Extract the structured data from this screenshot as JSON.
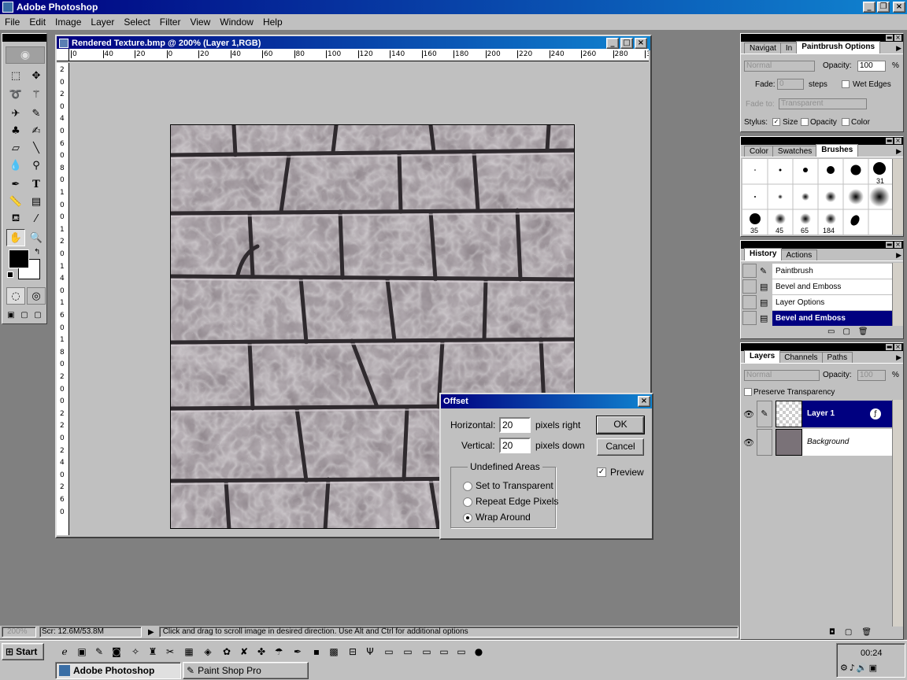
{
  "app": {
    "title": "Adobe Photoshop",
    "min": "_",
    "max": "❐",
    "close": "×"
  },
  "menu": [
    "File",
    "Edit",
    "Image",
    "Layer",
    "Select",
    "Filter",
    "View",
    "Window",
    "Help"
  ],
  "document": {
    "title": "Rendered Texture.bmp @ 200% (Layer 1,RGB)",
    "ruler_h": [
      "0",
      "40",
      "20",
      "0",
      "20",
      "40",
      "60",
      "80",
      "100",
      "120",
      "140",
      "160",
      "180",
      "200",
      "220",
      "240",
      "260",
      "280",
      "300"
    ],
    "ruler_v": [
      "2",
      "0",
      "2",
      "0",
      "4",
      "0",
      "6",
      "0",
      "8",
      "0",
      "1",
      "0",
      "0",
      "1",
      "2",
      "0",
      "1",
      "4",
      "0",
      "1",
      "6",
      "0",
      "1",
      "8",
      "0",
      "2",
      "0",
      "0",
      "2",
      "2",
      "0",
      "2",
      "4",
      "0",
      "2",
      "6",
      "0"
    ]
  },
  "dialog": {
    "title": "Offset",
    "horizontal_label": "Horizontal:",
    "horizontal_value": "20",
    "horizontal_unit": "pixels right",
    "vertical_label": "Vertical:",
    "vertical_value": "20",
    "vertical_unit": "pixels down",
    "ok": "OK",
    "cancel": "Cancel",
    "preview": "Preview",
    "preview_checked": true,
    "group_title": "Undefined Areas",
    "options": [
      "Set to Transparent",
      "Repeat Edge Pixels",
      "Wrap Around"
    ],
    "selected_option": 2
  },
  "options_palette": {
    "tabs": [
      "Navigat",
      "In",
      "Paintbrush Options"
    ],
    "mode": "Normal",
    "opacity_label": "Opacity:",
    "opacity_value": "100",
    "pct": "%",
    "fade_label": "Fade:",
    "fade_value": "0",
    "steps": "steps",
    "wet_edges": "Wet Edges",
    "fade_to_label": "Fade to:",
    "fade_to_value": "Transparent",
    "stylus_label": "Stylus:",
    "stylus_size": "Size",
    "stylus_opacity": "Opacity",
    "stylus_color": "Color"
  },
  "brushes_palette": {
    "tabs": [
      "Color",
      "Swatches",
      "Brushes"
    ],
    "labels": [
      "31",
      "35",
      "45",
      "65",
      "184"
    ]
  },
  "history_palette": {
    "tabs": [
      "History",
      "Actions"
    ],
    "items": [
      "Paintbrush",
      "Bevel and Emboss",
      "Layer Options",
      "Bevel and Emboss"
    ]
  },
  "layers_palette": {
    "tabs": [
      "Layers",
      "Channels",
      "Paths"
    ],
    "mode": "Normal",
    "opacity_label": "Opacity:",
    "opacity_value": "100",
    "pct": "%",
    "preserve": "Preserve Transparency",
    "layers": [
      "Layer 1",
      "Background"
    ]
  },
  "status": {
    "zoom": "200%",
    "scratch": "Scr: 12.6M/53.8M",
    "message": "Click and drag to scroll image in desired direction.  Use Alt and Ctrl for additional options"
  },
  "taskbar": {
    "start": "Start",
    "tasks": [
      "Adobe Photoshop",
      "Paint Shop Pro"
    ],
    "clock": "00:24"
  }
}
